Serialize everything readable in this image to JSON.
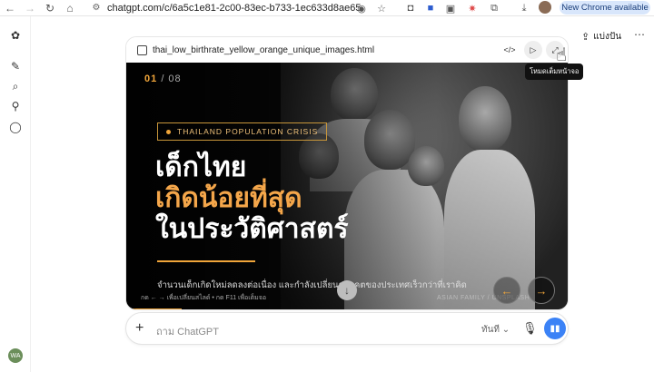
{
  "browser": {
    "url": "chatgpt.com/c/6a5c1e81-2c00-83ec-b733-1ec633d8ae65",
    "update_label": "New Chrome available",
    "icons": [
      "back-icon",
      "forward-icon",
      "reload-icon",
      "home-icon",
      "site-settings-icon",
      "cast-icon",
      "star-icon",
      "camera-icon",
      "extension-icon",
      "download-icon",
      "profile-avatar"
    ]
  },
  "sidebar": {
    "avatar_initials": "WA",
    "icons": [
      "chatgpt-logo-icon",
      "new-chat-icon",
      "search-icon",
      "pin-icon",
      "chat-bubble-icon"
    ]
  },
  "topbar": {
    "share_label": "แบ่งปัน",
    "more_label": "⋯"
  },
  "artifact": {
    "filename": "thai_low_birthrate_yellow_orange_unique_images.html",
    "tooltip": "โหมดเต็มหน้าจอ",
    "slide": {
      "current": "01",
      "total": "/ 08",
      "badge": "THAILAND POPULATION CRISIS",
      "title_line1": "เด็กไทย",
      "title_line2": "เกิดน้อยที่สุด",
      "title_line3": "ในประวัติศาสตร์",
      "subtitle": "จำนวนเด็กเกิดใหม่ลดลงต่อเนื่อง และกำลังเปลี่ยนอนาคตของประเทศเร็วกว่าที่เราคิด",
      "hint": "กด ← → เพื่อเปลี่ยนสไลด์ • กด F11 เพื่อเต็มจอ",
      "credit": "ASIAN FAMILY / UNSPLASH",
      "progress": 0.125
    },
    "colors": {
      "accent": "#f0a53a"
    }
  },
  "composer": {
    "placeholder": "ถาม ChatGPT",
    "model_label": "ทันที ⌄"
  }
}
